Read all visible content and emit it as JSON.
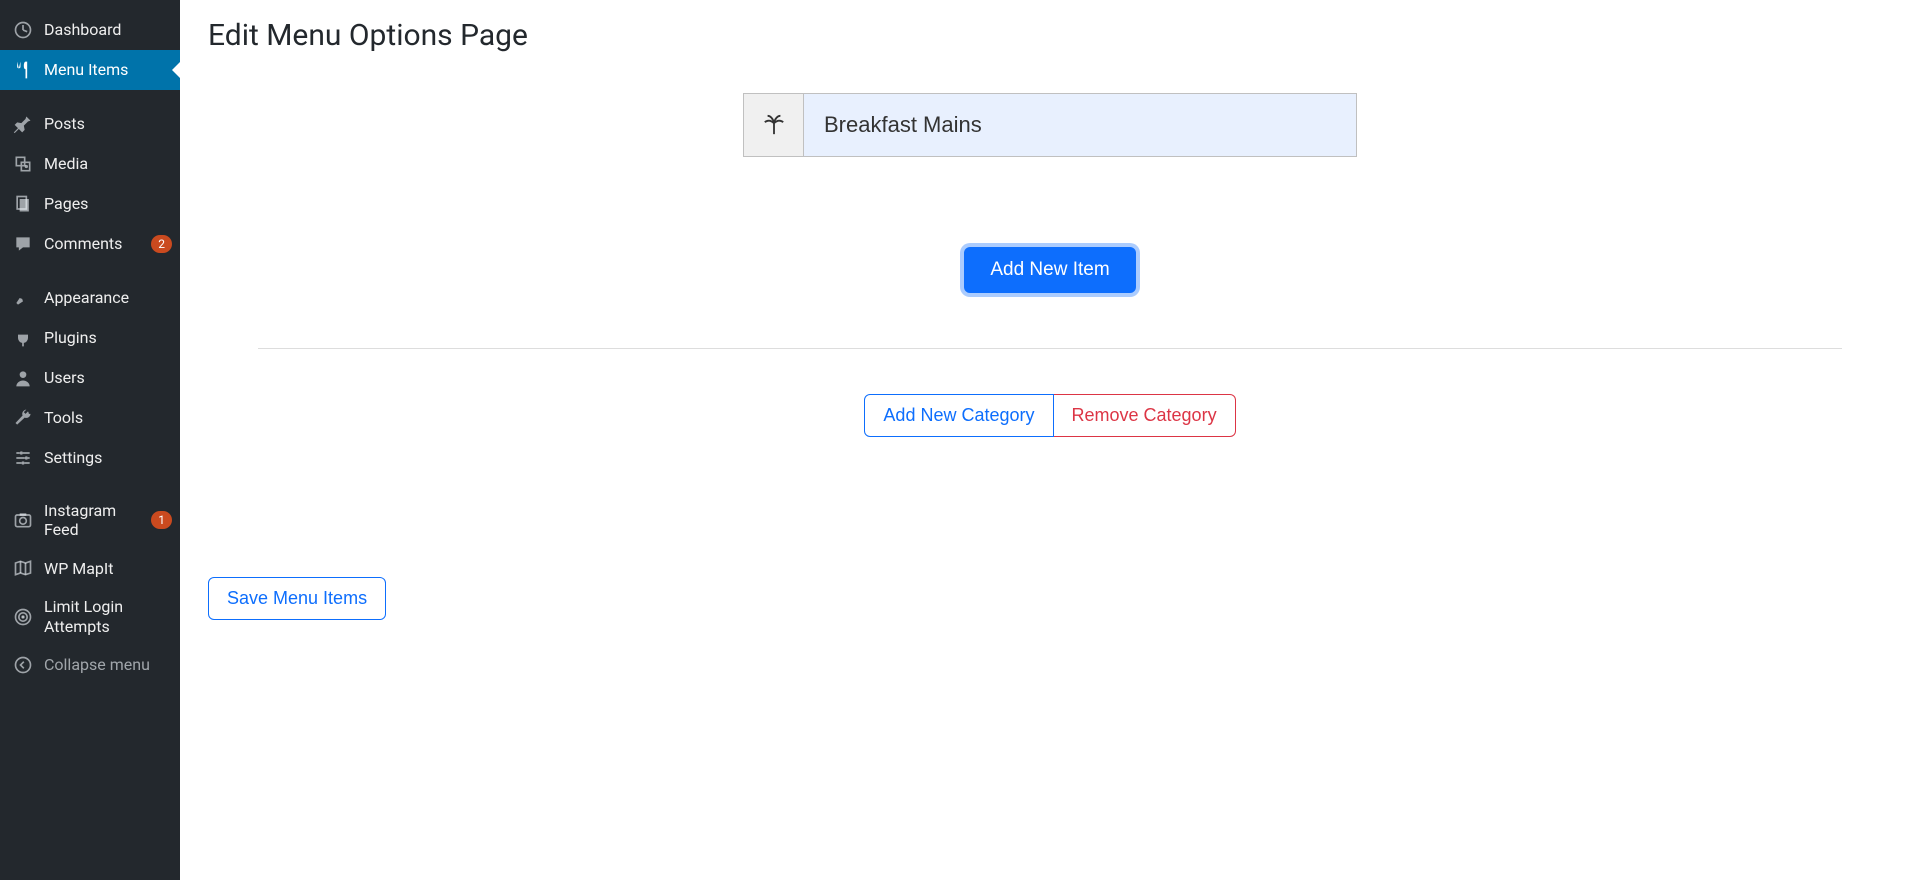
{
  "page": {
    "title": "Edit Menu Options Page",
    "category_value": "Breakfast Mains",
    "add_item_label": "Add New Item",
    "add_category_label": "Add New Category",
    "remove_category_label": "Remove Category",
    "save_label": "Save Menu Items"
  },
  "sidebar": {
    "items": [
      {
        "label": "Dashboard",
        "icon": "dashboard"
      },
      {
        "label": "Menu Items",
        "icon": "utensils",
        "active": true
      },
      {
        "separator": true
      },
      {
        "label": "Posts",
        "icon": "pin"
      },
      {
        "label": "Media",
        "icon": "media"
      },
      {
        "label": "Pages",
        "icon": "pages"
      },
      {
        "label": "Comments",
        "icon": "comments",
        "badge": "2"
      },
      {
        "separator": true
      },
      {
        "label": "Appearance",
        "icon": "brush"
      },
      {
        "label": "Plugins",
        "icon": "plug"
      },
      {
        "label": "Users",
        "icon": "user"
      },
      {
        "label": "Tools",
        "icon": "wrench"
      },
      {
        "label": "Settings",
        "icon": "sliders"
      },
      {
        "separator": true
      },
      {
        "label": "Instagram Feed",
        "icon": "camera",
        "badge": "1"
      },
      {
        "label": "WP MapIt",
        "icon": "map"
      },
      {
        "label": "Limit Login Attempts",
        "icon": "fingerprint"
      },
      {
        "label": "Collapse menu",
        "icon": "collapse",
        "collapse": true
      }
    ]
  }
}
